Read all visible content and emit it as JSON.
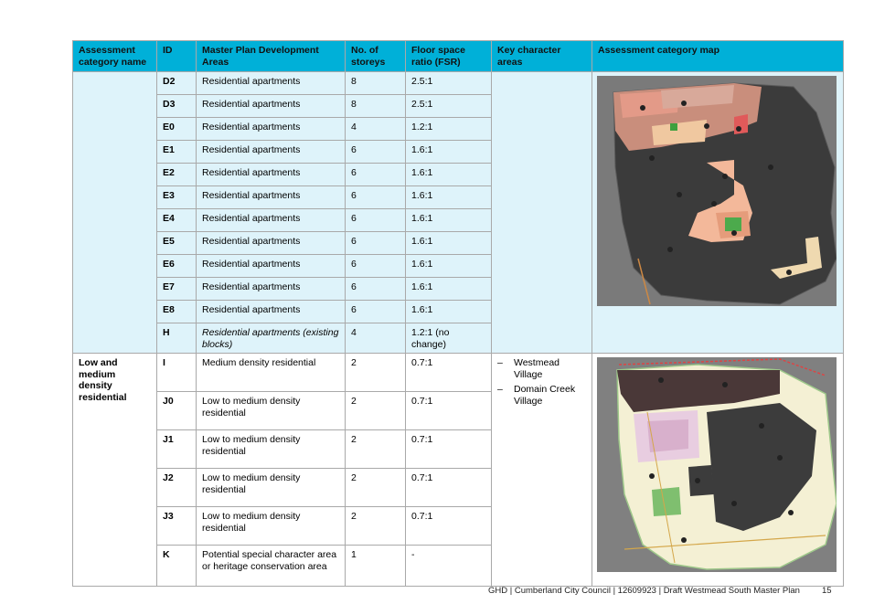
{
  "headers": {
    "category": "Assessment category name",
    "id": "ID",
    "areas": "Master Plan Development Areas",
    "storeys": "No. of storeys",
    "fsr": "Floor space ratio (FSR)",
    "key_areas": "Key character areas",
    "map": "Assessment category map"
  },
  "group1": {
    "rows": [
      {
        "id": "D2",
        "area": "Residential apartments",
        "storeys": "8",
        "fsr": "2.5:1"
      },
      {
        "id": "D3",
        "area": "Residential apartments",
        "storeys": "8",
        "fsr": "2.5:1"
      },
      {
        "id": "E0",
        "area": "Residential apartments",
        "storeys": "4",
        "fsr": "1.2:1"
      },
      {
        "id": "E1",
        "area": "Residential apartments",
        "storeys": "6",
        "fsr": "1.6:1"
      },
      {
        "id": "E2",
        "area": "Residential apartments",
        "storeys": "6",
        "fsr": "1.6:1"
      },
      {
        "id": "E3",
        "area": "Residential apartments",
        "storeys": "6",
        "fsr": "1.6:1"
      },
      {
        "id": "E4",
        "area": "Residential apartments",
        "storeys": "6",
        "fsr": "1.6:1"
      },
      {
        "id": "E5",
        "area": "Residential apartments",
        "storeys": "6",
        "fsr": "1.6:1"
      },
      {
        "id": "E6",
        "area": "Residential apartments",
        "storeys": "6",
        "fsr": "1.6:1"
      },
      {
        "id": "E7",
        "area": "Residential apartments",
        "storeys": "6",
        "fsr": "1.6:1"
      },
      {
        "id": "E8",
        "area": "Residential apartments",
        "storeys": "6",
        "fsr": "1.6:1"
      },
      {
        "id": "H",
        "area": "Residential apartments (existing blocks)",
        "storeys": "4",
        "fsr": "1.2:1 (no change)"
      }
    ]
  },
  "group2": {
    "category": "Low and medium density residential",
    "key_areas": [
      "Westmead Village",
      "Domain Creek Village"
    ],
    "rows": [
      {
        "id": "I",
        "area": "Medium density residential",
        "storeys": "2",
        "fsr": "0.7:1"
      },
      {
        "id": "J0",
        "area": "Low to medium density residential",
        "storeys": "2",
        "fsr": "0.7:1"
      },
      {
        "id": "J1",
        "area": "Low to medium density residential",
        "storeys": "2",
        "fsr": "0.7:1"
      },
      {
        "id": "J2",
        "area": "Low to medium density residential",
        "storeys": "2",
        "fsr": "0.7:1"
      },
      {
        "id": "J3",
        "area": "Low to medium density residential",
        "storeys": "2",
        "fsr": "0.7:1"
      },
      {
        "id": "K",
        "area": "Potential special character area or heritage conservation area",
        "storeys": "1",
        "fsr": "-"
      }
    ]
  },
  "footer": {
    "text": "GHD | Cumberland City Council | 12609923 | Draft Westmead South Master Plan",
    "page": "15"
  },
  "colors": {
    "header_bg": "#00b0d8",
    "row_tint": "#def3fa"
  }
}
